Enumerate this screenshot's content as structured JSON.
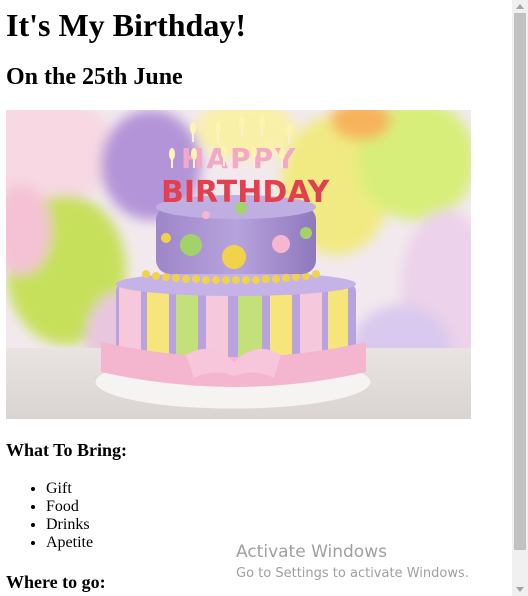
{
  "page": {
    "title": "It's My Birthday!",
    "subtitle": "On the 25th June"
  },
  "image": {
    "cake_lettering_top": "HAPPY",
    "cake_lettering_bottom": "BIRTHDAY"
  },
  "bring": {
    "heading": "What To Bring:",
    "items": [
      "Gift",
      "Food",
      "Drinks",
      "Apetite"
    ]
  },
  "where": {
    "heading": "Where to go:"
  },
  "watermark": {
    "title": "Activate Windows",
    "subtitle": "Go to Settings to activate Windows."
  }
}
